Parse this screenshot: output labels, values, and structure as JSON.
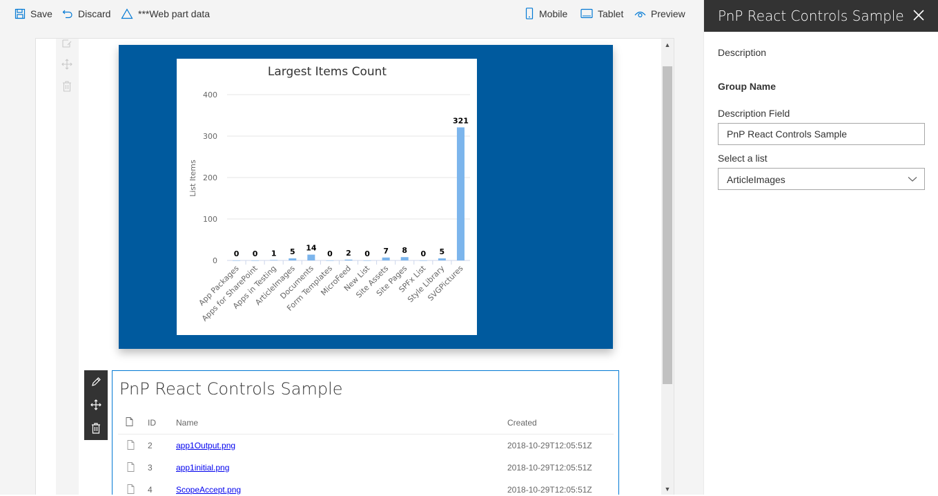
{
  "commandbar": {
    "save_label": "Save",
    "discard_label": "Discard",
    "webpart_data_label": "***Web part data",
    "mobile_label": "Mobile",
    "tablet_label": "Tablet",
    "preview_label": "Preview"
  },
  "chart_data": {
    "type": "bar",
    "title": "Largest Items Count",
    "xlabel": "",
    "ylabel": "List Items",
    "ylim": [
      0,
      400
    ],
    "yticks": [
      "0",
      "100",
      "200",
      "300",
      "400"
    ],
    "categories": [
      "App Packages",
      "Apps for SharePoint",
      "Apps in Testing",
      "ArticleImages",
      "Documents",
      "Form Templates",
      "MicroFeed",
      "New List",
      "Site Assets",
      "Site Pages",
      "SPFx List",
      "Style Library",
      "SVGPictures"
    ],
    "values": [
      0,
      0,
      1,
      5,
      14,
      0,
      2,
      0,
      7,
      8,
      0,
      5,
      321
    ],
    "value_labels": [
      "0",
      "0",
      "1",
      "5",
      "14",
      "0",
      "2",
      "0",
      "7",
      "8",
      "0",
      "5",
      "321"
    ],
    "bar_color": "#7cb5ec",
    "grid": true,
    "legend": "none"
  },
  "list_webpart": {
    "title": "PnP React Controls Sample",
    "columns": {
      "id": "ID",
      "name": "Name",
      "created": "Created"
    },
    "rows": [
      {
        "id": "2",
        "name": "app1Output.png",
        "created": "2018-10-29T12:05:51Z"
      },
      {
        "id": "3",
        "name": "app1initial.png",
        "created": "2018-10-29T12:05:51Z"
      },
      {
        "id": "4",
        "name": "ScopeAccept.png",
        "created": "2018-10-29T12:05:51Z"
      }
    ]
  },
  "property_pane": {
    "title": "PnP React Controls Sample",
    "description": "Description",
    "group_name": "Group Name",
    "description_field_label": "Description Field",
    "description_field_value": "PnP React Controls Sample",
    "select_list_label": "Select a list",
    "select_list_value": "ArticleImages"
  },
  "colors": {
    "accent": "#0078d4",
    "chart_webpart_bg": "#005a9e",
    "pane_header_bg": "#333333"
  }
}
